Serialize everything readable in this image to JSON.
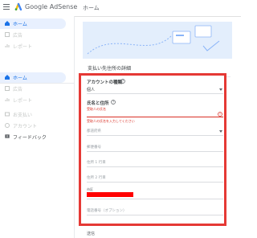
{
  "app": {
    "brand": "Google AdSense"
  },
  "header": {
    "breadcrumb": "ホーム"
  },
  "sidebar": {
    "top_items": [
      {
        "label": "ホーム",
        "icon": "home-icon",
        "active": true
      },
      {
        "label": "広告",
        "icon": "ads-icon",
        "active": false
      },
      {
        "label": "レポート",
        "icon": "reports-icon",
        "active": false
      }
    ],
    "bottom_items": [
      {
        "label": "ホーム",
        "icon": "home-icon",
        "active": true
      },
      {
        "label": "広告",
        "icon": "ads-icon",
        "active": false
      },
      {
        "label": "レポート",
        "icon": "reports-icon",
        "active": false
      },
      {
        "label": "お支払い",
        "icon": "payments-icon",
        "active": false
      },
      {
        "label": "アカウント",
        "icon": "account-icon",
        "active": false
      },
      {
        "label": "フィードバック",
        "icon": "feedback-icon",
        "active": false
      }
    ]
  },
  "main": {
    "page_title": "支払い先住所の詳細",
    "form": {
      "account_type_label": "アカウントの種類",
      "account_type_value": "個人",
      "name_address_label": "氏名と住所",
      "name_field_label": "受取人の氏名",
      "name_error": "受取人の氏名を入力してください",
      "prefecture_placeholder": "都道府県",
      "postal_code_placeholder": "郵便番号",
      "address_line1_placeholder": "住所 1 行目",
      "address_line2_placeholder": "住所 2 行目",
      "city_label": "市区",
      "phone_placeholder": "電話番号（オプション）"
    },
    "bottom_label": "送信"
  },
  "colors": {
    "accent": "#1a73e8",
    "highlight_border": "#e53935",
    "error": "#d93025",
    "active_nav_bg": "#e8f0fe",
    "banner_bg": "#e3eefc"
  }
}
